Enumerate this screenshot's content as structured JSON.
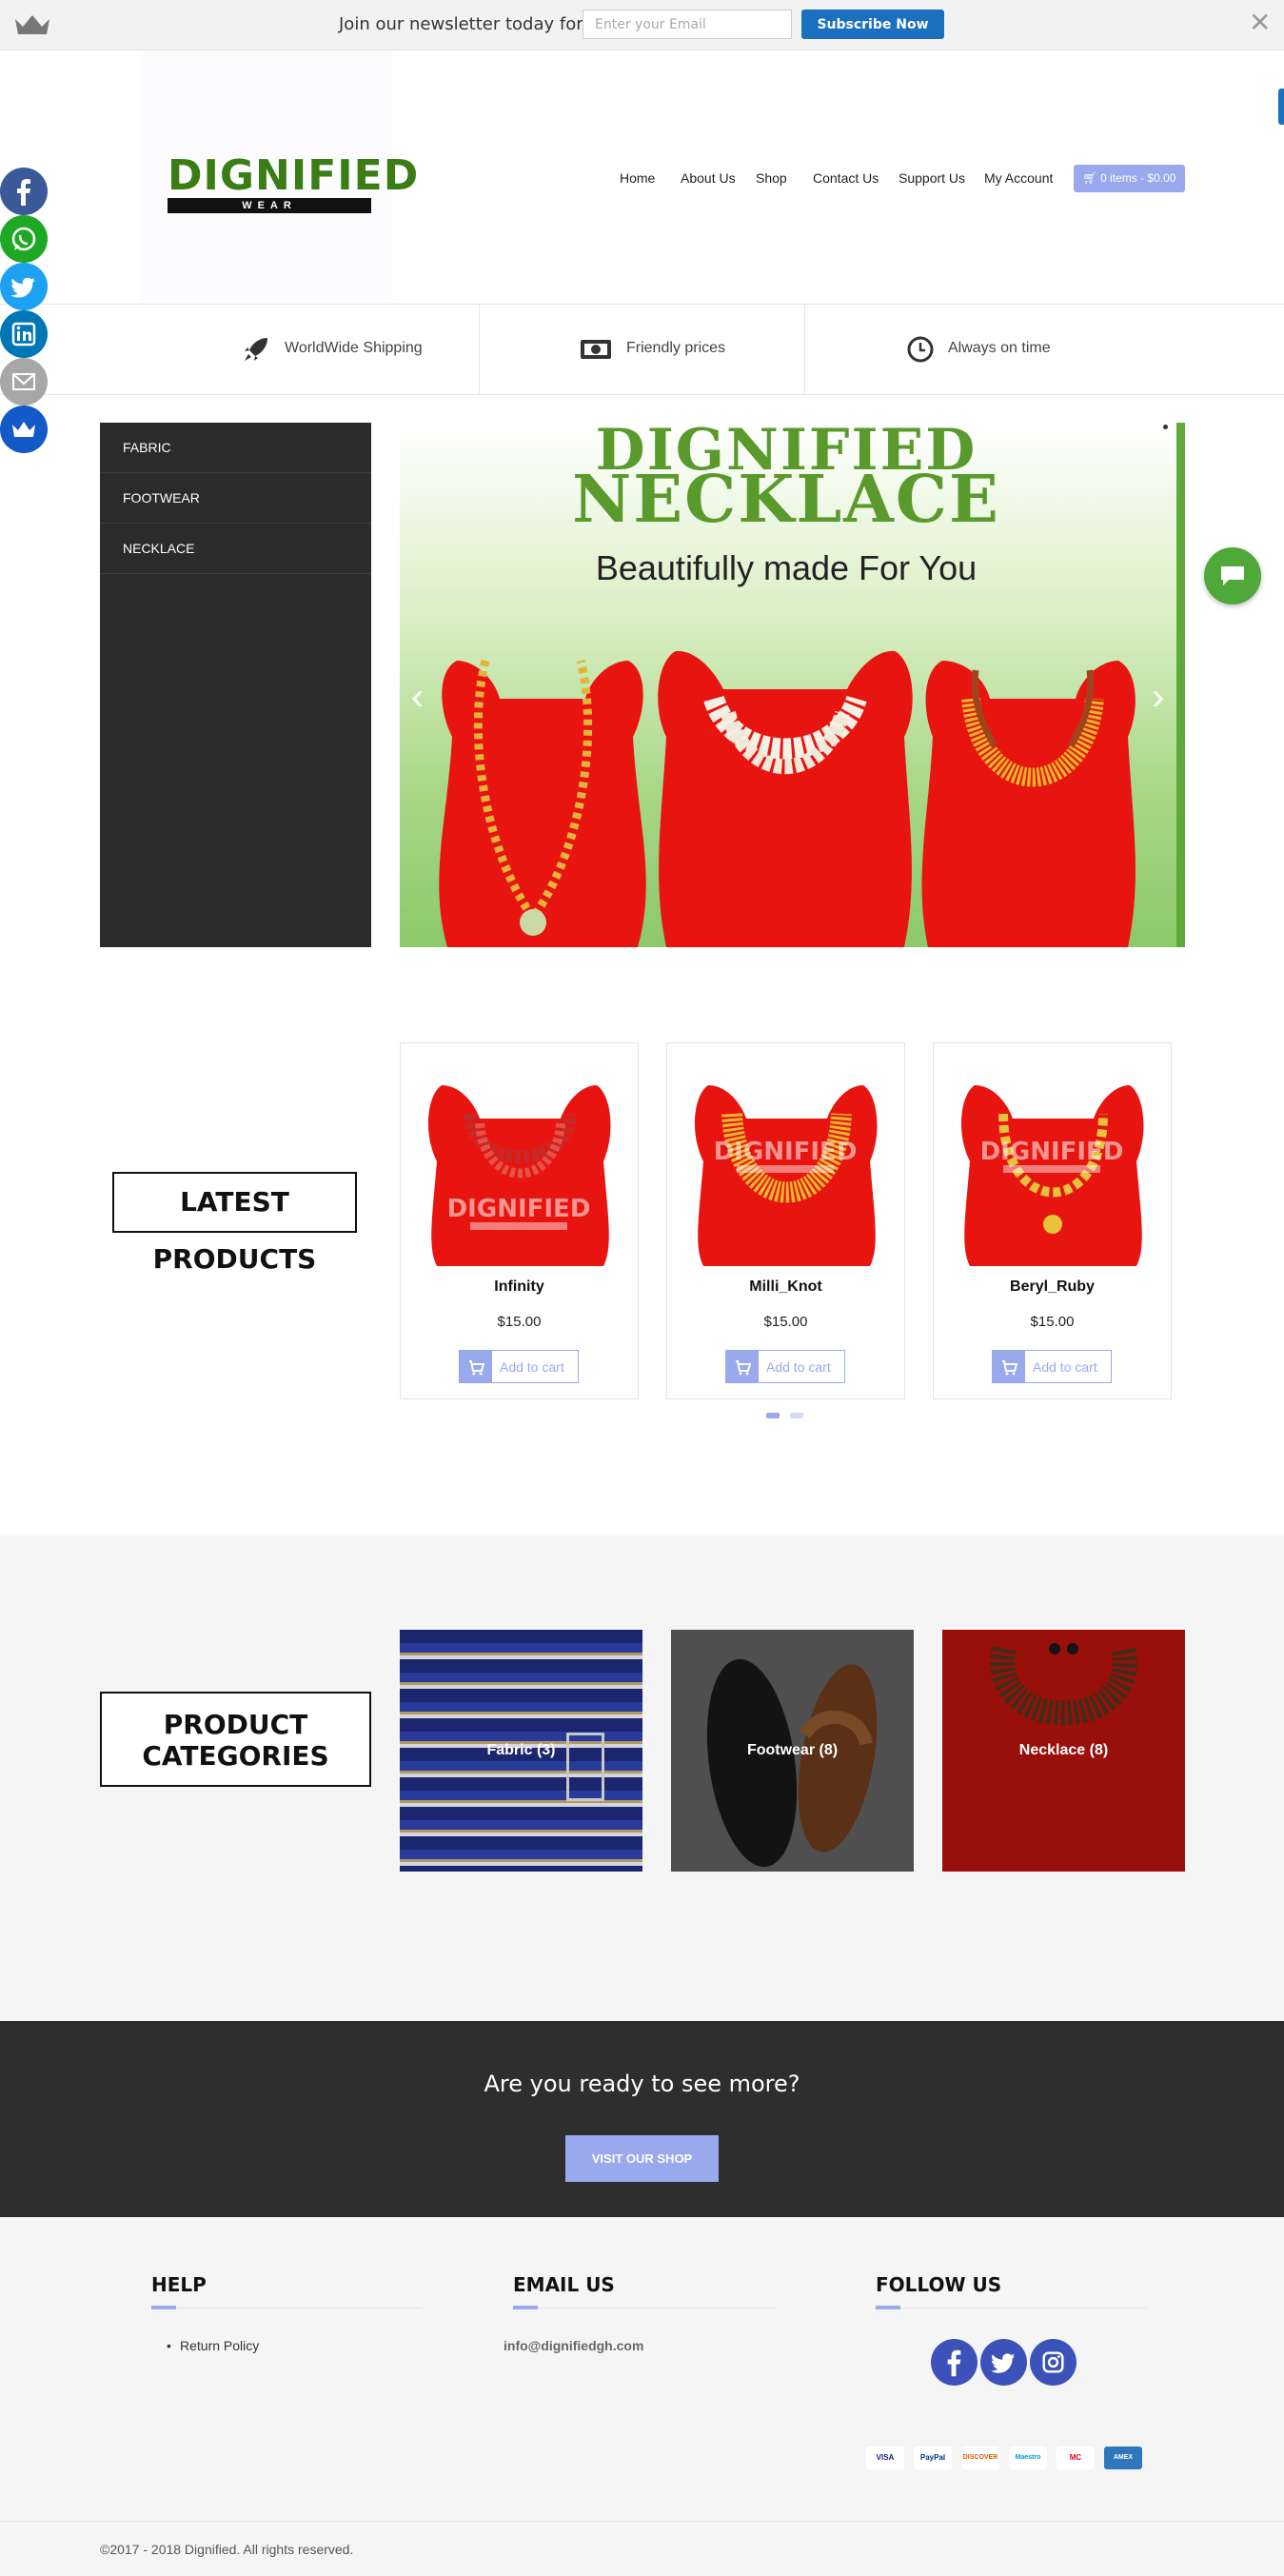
{
  "newsletter": {
    "text": "Join our newsletter today for free",
    "placeholder": "Enter your Email",
    "button": "Subscribe Now",
    "close": "✕"
  },
  "brand": {
    "logo_word": "DIGNIFIED",
    "logo_sub": "WEAR"
  },
  "nav": {
    "items": [
      "Home",
      "About Us",
      "Shop",
      "Contact Us",
      "Support Us",
      "My Account"
    ],
    "cart": "0 items - $0.00"
  },
  "features": [
    {
      "icon": "rocket-icon",
      "label": "WorldWide Shipping"
    },
    {
      "icon": "money-icon",
      "label": "Friendly prices"
    },
    {
      "icon": "clock-icon",
      "label": "Always on time"
    }
  ],
  "social_share": [
    "facebook",
    "whatsapp",
    "twitter",
    "linkedin",
    "email",
    "sumome"
  ],
  "categories_menu": [
    "FABRIC",
    "FOOTWEAR",
    "NECKLACE"
  ],
  "slider": {
    "title_line1": "DIGNIFIED",
    "title_line2": "NECKLACE",
    "subtitle": "Beautifully made For You",
    "prev": "‹",
    "next": "›"
  },
  "latest": {
    "title": "LATEST PRODUCTS",
    "products": [
      {
        "name": "Infinity",
        "price": "$15.00",
        "cart": "Add to cart"
      },
      {
        "name": "Milli_Knot",
        "price": "$15.00",
        "cart": "Add to cart"
      },
      {
        "name": "Beryl_Ruby",
        "price": "$15.00",
        "cart": "Add to cart"
      }
    ],
    "watermark_word": "DIGNIFIED",
    "watermark_sub": "WEAR"
  },
  "product_categories": {
    "title_line1": "PRODUCT",
    "title_line2": "CATEGORIES",
    "tiles": [
      {
        "label": "Fabric  (3)"
      },
      {
        "label": "Footwear  (8)"
      },
      {
        "label": "Necklace  (8)"
      }
    ]
  },
  "cta": {
    "text": "Are you ready to see more?",
    "button": "VISIT OUR SHOP"
  },
  "footer": {
    "help_title": "HELP",
    "help_link": "Return Policy",
    "email_title": "EMAIL US",
    "email": "info@dignifiedgh.com",
    "follow_title": "FOLLOW US",
    "payments": [
      "VISA",
      "PayPal",
      "DISCOVER",
      "Maestro",
      "MC",
      "AMEX"
    ],
    "copyright": "©2017 - 2018 Dignified. All rights reserved."
  },
  "colors": {
    "accent": "#9aa8ee",
    "subscribe": "#1b6fbf",
    "brand_green": "#3a7d14",
    "dark": "#2b2b2b"
  }
}
